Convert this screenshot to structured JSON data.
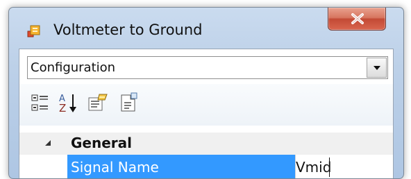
{
  "window": {
    "title": "Voltmeter to Ground",
    "close_icon": "close-icon"
  },
  "selector": {
    "value": "Configuration",
    "dropdown_icon": "chevron-down-icon"
  },
  "toolbar": {
    "items": [
      {
        "name": "categorized-icon"
      },
      {
        "name": "alphabetical-sort-icon"
      },
      {
        "name": "property-pages-icon"
      },
      {
        "name": "page-settings-icon"
      }
    ]
  },
  "property_grid": {
    "category": "General",
    "property_name": "Signal Name",
    "property_value": "Vmid"
  },
  "colors": {
    "selection": "#3399ff",
    "close_button": "#c34a35"
  }
}
